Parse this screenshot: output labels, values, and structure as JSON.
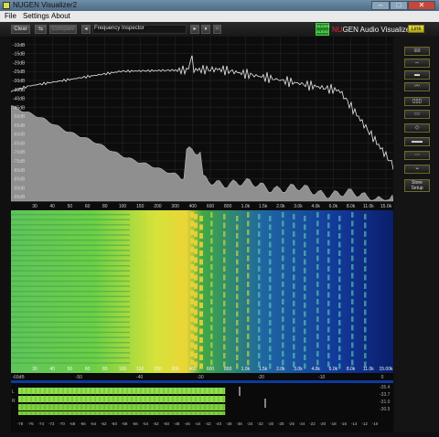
{
  "window": {
    "title": "NUGEN Visualizer2",
    "minimize": "–",
    "maximize": "□",
    "close": "✕"
  },
  "menu": [
    "File",
    "Settings",
    "About"
  ],
  "toolbar": {
    "clear": "Clear",
    "swap": "⇆",
    "compare": "Compare",
    "back": "◂",
    "inspector": "Frequency Inspector",
    "next": "▸",
    "pause": "⏸",
    "window": "▫"
  },
  "brand": {
    "logo": "NUGEN AUDIO",
    "name_prefix": "NU",
    "name_rest": "GEN Audio Visualizer",
    "link": "Link"
  },
  "colors": {
    "spectrum_fill": "#8f8f8f",
    "spectrum_line": "#ededed",
    "accent": "#d8c832",
    "meter_green": "#8ee04a"
  },
  "spectrum": {
    "db_labels": [
      "-10dB",
      "-15dB",
      "-20dB",
      "-25dB",
      "-30dB",
      "-35dB",
      "-40dB",
      "-45dB",
      "-50dB",
      "-55dB",
      "-60dB",
      "-65dB",
      "-70dB",
      "-75dB",
      "-80dB",
      "-85dB",
      "-90dB",
      "-95dB"
    ],
    "freq_labels": [
      "30",
      "40",
      "50",
      "60",
      "80",
      "100",
      "150",
      "200",
      "300",
      "400",
      "600",
      "800",
      "1.0k",
      "1.5k",
      "2.0k",
      "3.0k",
      "4.0k",
      "6.0k",
      "8.0k",
      "11.0k",
      "15.0k"
    ]
  },
  "spectrogram": {
    "freq_labels": [
      "30",
      "40",
      "50",
      "60",
      "80",
      "100",
      "150",
      "200",
      "300",
      "400",
      "600",
      "800",
      "1.0k",
      "1.5k",
      "2.0k",
      "3.0k",
      "4.0k",
      "6.0k",
      "8.0k",
      "11.0k",
      "15.00k"
    ]
  },
  "meter": {
    "scale_top": [
      "-60dB",
      "-50",
      "-40",
      "-30",
      "-20",
      "-10",
      "0"
    ],
    "channels": [
      "L",
      "R"
    ],
    "readouts": [
      "-35.4",
      "-33.7",
      "-31.0",
      "-30.5"
    ],
    "scale_bottom": [
      "-78",
      "-76",
      "-74",
      "-72",
      "-70",
      "-68",
      "-66",
      "-64",
      "-62",
      "-60",
      "-58",
      "-56",
      "-54",
      "-52",
      "-50",
      "-48",
      "-46",
      "-44",
      "-42",
      "-40",
      "-38",
      "-36",
      "-34",
      "-32",
      "-30",
      "-28",
      "-26",
      "-24",
      "-22",
      "-20",
      "-18",
      "-16",
      "-14",
      "-12",
      "-10"
    ],
    "level_L": 0.58,
    "level_R": 0.58
  },
  "right_panel": {
    "buttons": [
      "≡≡",
      "⇔",
      "▬",
      "〰",
      "▯▯▯",
      "▭",
      "◇",
      "▬▬",
      "⋯",
      "⌁"
    ],
    "store_setup": "Store Setup"
  }
}
